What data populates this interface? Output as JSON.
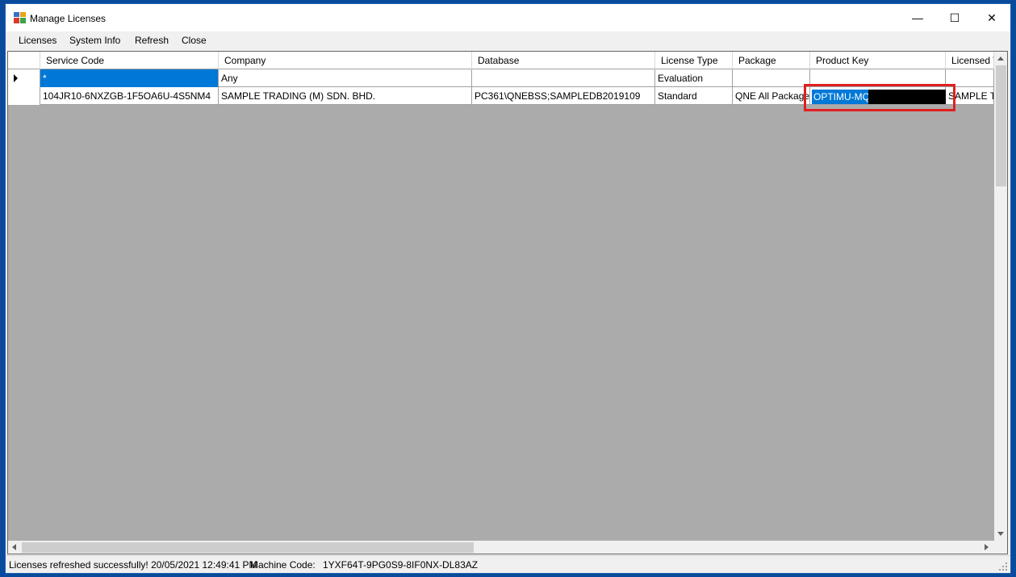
{
  "window": {
    "title": "Manage Licenses",
    "icon": "licenses-app-icon"
  },
  "controls": {
    "minimize": "—",
    "maximize": "☐",
    "close": "✕"
  },
  "menu": {
    "licenses": "Licenses",
    "system_info": "System Info",
    "refresh": "Refresh",
    "close": "Close"
  },
  "grid": {
    "columns": [
      "Service Code",
      "Company",
      "Database",
      "License Type",
      "Package",
      "Product Key",
      "Licensed T"
    ],
    "rows": [
      {
        "service_code": "*",
        "company": "Any",
        "database": "",
        "license_type": "Evaluation",
        "package": "",
        "product_key": "",
        "licensed_to": ""
      },
      {
        "service_code": "104JR10-6NXZGB-1F5OA6U-4S5NM4",
        "company": "SAMPLE TRADING (M) SDN. BHD.",
        "database": "PC361\\QNEBSS;SAMPLEDB2019109",
        "license_type": "Standard",
        "package": "QNE All Packages",
        "product_key": "OPTIMU-MQN",
        "licensed_to": "SAMPLE TR"
      }
    ]
  },
  "status": {
    "message": "Licenses refreshed successfully! 20/05/2021 12:49:41 PM",
    "machine_code_label": "Machine Code:",
    "machine_code_value": "1YXF64T-9PG0S9-8IF0NX-DL83AZ"
  },
  "colors": {
    "selection": "#0078d7",
    "highlight_border": "#e0201e",
    "grid_background": "#ababab",
    "desktop": "#0a4a9c"
  }
}
